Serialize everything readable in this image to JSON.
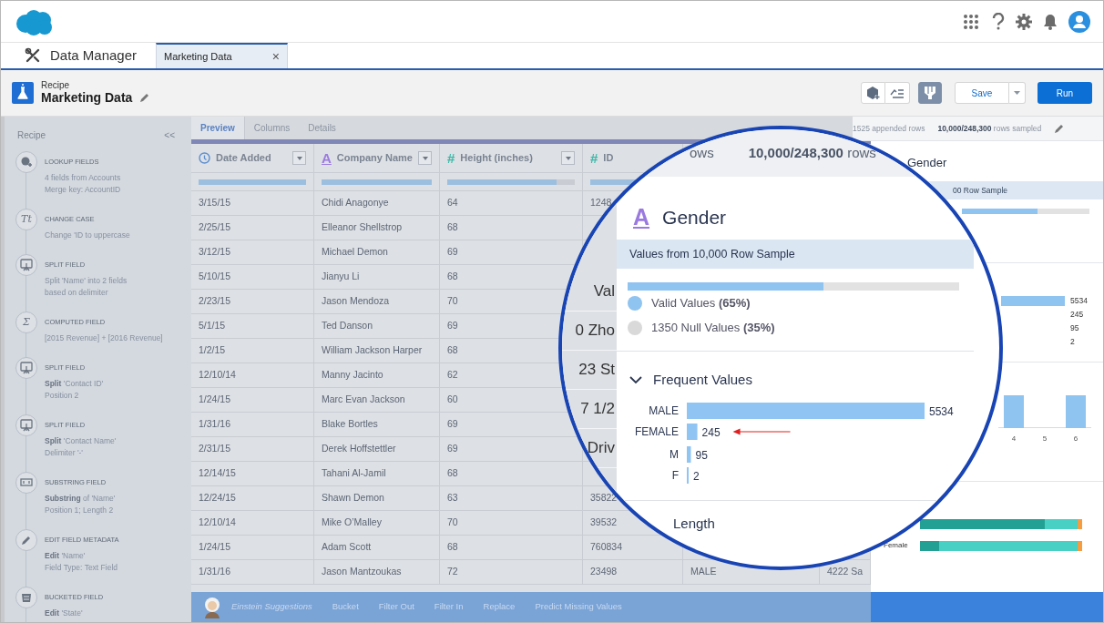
{
  "nav": {
    "app_name": "Data Manager",
    "tabs": [
      {
        "label": "Marketing Data",
        "selected": true,
        "close": "×"
      }
    ]
  },
  "header": {
    "type_label": "Recipe",
    "title": "Marketing Data",
    "buttons": [
      {
        "label": "Save",
        "kind": "split"
      },
      {
        "label": "Run",
        "kind": "primary"
      }
    ]
  },
  "sidebar": {
    "title": "Recipe",
    "collapse": "<<",
    "steps": [
      {
        "kind": "lookup",
        "title": "LOOKUP FIELDS",
        "lines": [
          "4 fields from Accounts",
          "Merge key: AccountID"
        ]
      },
      {
        "kind": "case",
        "glyph": "Tt",
        "title": "CHANGE CASE",
        "lines": [
          "Change 'ID to uppercase"
        ]
      },
      {
        "kind": "split",
        "title": "SPLIT FIELD",
        "lines": [
          "Split 'Name' into 2 fields",
          "based on delimiter"
        ]
      },
      {
        "kind": "computed",
        "glyph": "Σ",
        "title": "COMPUTED FIELD",
        "lines": [
          "[2015 Revenue] + [2016 Revenue]"
        ]
      },
      {
        "kind": "split",
        "title": "SPLIT FIELD",
        "lines": [
          "**Split** 'Contact ID'",
          "Position 2"
        ]
      },
      {
        "kind": "split",
        "title": "SPLIT FIELD",
        "lines": [
          "**Split** 'Contact Name'",
          "Delimiter '-'"
        ]
      },
      {
        "kind": "substring",
        "title": "SUBSTRING FIELD",
        "lines": [
          "**Substring** of 'Name'",
          "Position 1; Length 2"
        ]
      },
      {
        "kind": "edit",
        "title": "EDIT FIELD METADATA",
        "lines": [
          "**Edit** 'Name'",
          "Field Type: Text Field"
        ]
      },
      {
        "kind": "bucket",
        "title": "BUCKETED FIELD",
        "lines": [
          "**Edit** 'State'"
        ]
      }
    ]
  },
  "table": {
    "tabs": [
      {
        "label": "Preview",
        "selected": true
      },
      {
        "label": "Columns",
        "selected": false
      },
      {
        "label": "Details",
        "selected": false
      }
    ],
    "columns": [
      {
        "name": "Date Added",
        "kind": "date",
        "level": 1
      },
      {
        "name": "Company Name",
        "kind": "text",
        "glyph": "A",
        "level": 1
      },
      {
        "name": "Height (inches)",
        "kind": "number",
        "glyph": "#",
        "level": 0.86
      },
      {
        "name": "ID",
        "kind": "number",
        "glyph": "#",
        "level": 1
      }
    ],
    "rows": [
      [
        "3/15/15",
        "Chidi Anagonye",
        "64",
        "1248",
        null,
        null
      ],
      [
        "2/25/15",
        "Elleanor Shellstrop",
        "68",
        null,
        null,
        null
      ],
      [
        "3/12/15",
        "Michael Demon",
        "69",
        null,
        null,
        null
      ],
      [
        "5/10/15",
        "Jianyu Li",
        "68",
        null,
        null,
        null
      ],
      [
        "2/23/15",
        "Jason Mendoza",
        "70",
        null,
        null,
        null
      ],
      [
        "5/1/15",
        "Ted Danson",
        "69",
        null,
        null,
        null
      ],
      [
        "1/2/15",
        "William Jackson Harper",
        "68",
        null,
        null,
        null
      ],
      [
        "12/10/14",
        "Manny Jacinto",
        "62",
        null,
        null,
        null
      ],
      [
        "1/24/15",
        "Marc Evan Jackson",
        "60",
        null,
        null,
        null
      ],
      [
        "1/31/16",
        "Blake Bortles",
        "69",
        null,
        null,
        null
      ],
      [
        "2/31/15",
        "Derek Hoffstettler",
        "69",
        null,
        null,
        null
      ],
      [
        "12/14/15",
        "Tahani Al-Jamil",
        "68",
        null,
        null,
        null
      ],
      [
        "12/24/15",
        "Shawn Demon",
        "63",
        "35822",
        null,
        null
      ],
      [
        "12/10/14",
        "Mike O’Malley",
        "70",
        "39532",
        null,
        null
      ],
      [
        "1/24/15",
        "Adam Scott",
        "68",
        "760834",
        null,
        null
      ],
      [
        "1/31/16",
        "Jason Mantzoukas",
        "72",
        "23498",
        "MALE",
        "4222 Sa"
      ]
    ]
  },
  "einstein": {
    "label": "Einstein Suggestions",
    "actions": [
      "Bucket",
      "Filter Out",
      "Filter In",
      "Replace",
      "Predict Missing Values"
    ]
  },
  "right_panel": {
    "appended": "1525 appended rows",
    "sampled": "**10,000/248,300** rows sampled",
    "field_title": "Gender",
    "sample_band": "00 Row Sample",
    "valid_bar": {
      "level": 0.59
    },
    "counts": [
      {
        "value": "5534",
        "has_bar": true
      },
      {
        "value": "245",
        "has_bar": false
      },
      {
        "value": "95",
        "has_bar": false
      },
      {
        "value": "2",
        "has_bar": false
      }
    ],
    "histogram": [
      {
        "label": "4",
        "has_bar": true
      },
      {
        "label": "5",
        "has_bar": false
      },
      {
        "label": "6",
        "has_bar": true
      }
    ],
    "stacked_rows": [
      {
        "segments": [
          {
            "color": "#23a094",
            "level": 0.77
          },
          {
            "color": "#48d0c5",
            "level": 0.2
          },
          {
            "color": "#f59b42",
            "level": 0.03
          }
        ]
      },
      {
        "label": "Female",
        "segments": [
          {
            "color": "#23a094",
            "level": 0.12
          },
          {
            "color": "#48d0c5",
            "level": 0.85
          },
          {
            "color": "#f59b42",
            "level": 0.03
          }
        ]
      }
    ]
  },
  "magnifier": {
    "rows_label": "ows",
    "sampled": "**10,000/248,300** rows",
    "fragments": [
      "Val",
      "0 Zho",
      "23 St",
      "7 1/2",
      "Driv"
    ],
    "field": {
      "kind": "text",
      "glyph": "A",
      "title": "Gender",
      "sample_band": "Values from 10,000 Row Sample",
      "valid_bar": {
        "level": 0.59
      },
      "legend": [
        {
          "label": "Valid Values **(65%)**",
          "color": "#8fc3f0"
        },
        {
          "label": "1350 Null Values **(35%)**",
          "color": "#d9d9d9"
        }
      ],
      "frequent": {
        "title": "Frequent Values",
        "expanded": true,
        "chart_data": {
          "type": "bar",
          "orientation": "horizontal",
          "categories": [
            "MALE",
            "FEMALE",
            "M",
            "F"
          ],
          "values": [
            5534,
            245,
            95,
            2
          ],
          "value_labels": [
            "5534",
            "245",
            "95",
            "2"
          ]
        }
      },
      "next_section": "Length"
    }
  }
}
